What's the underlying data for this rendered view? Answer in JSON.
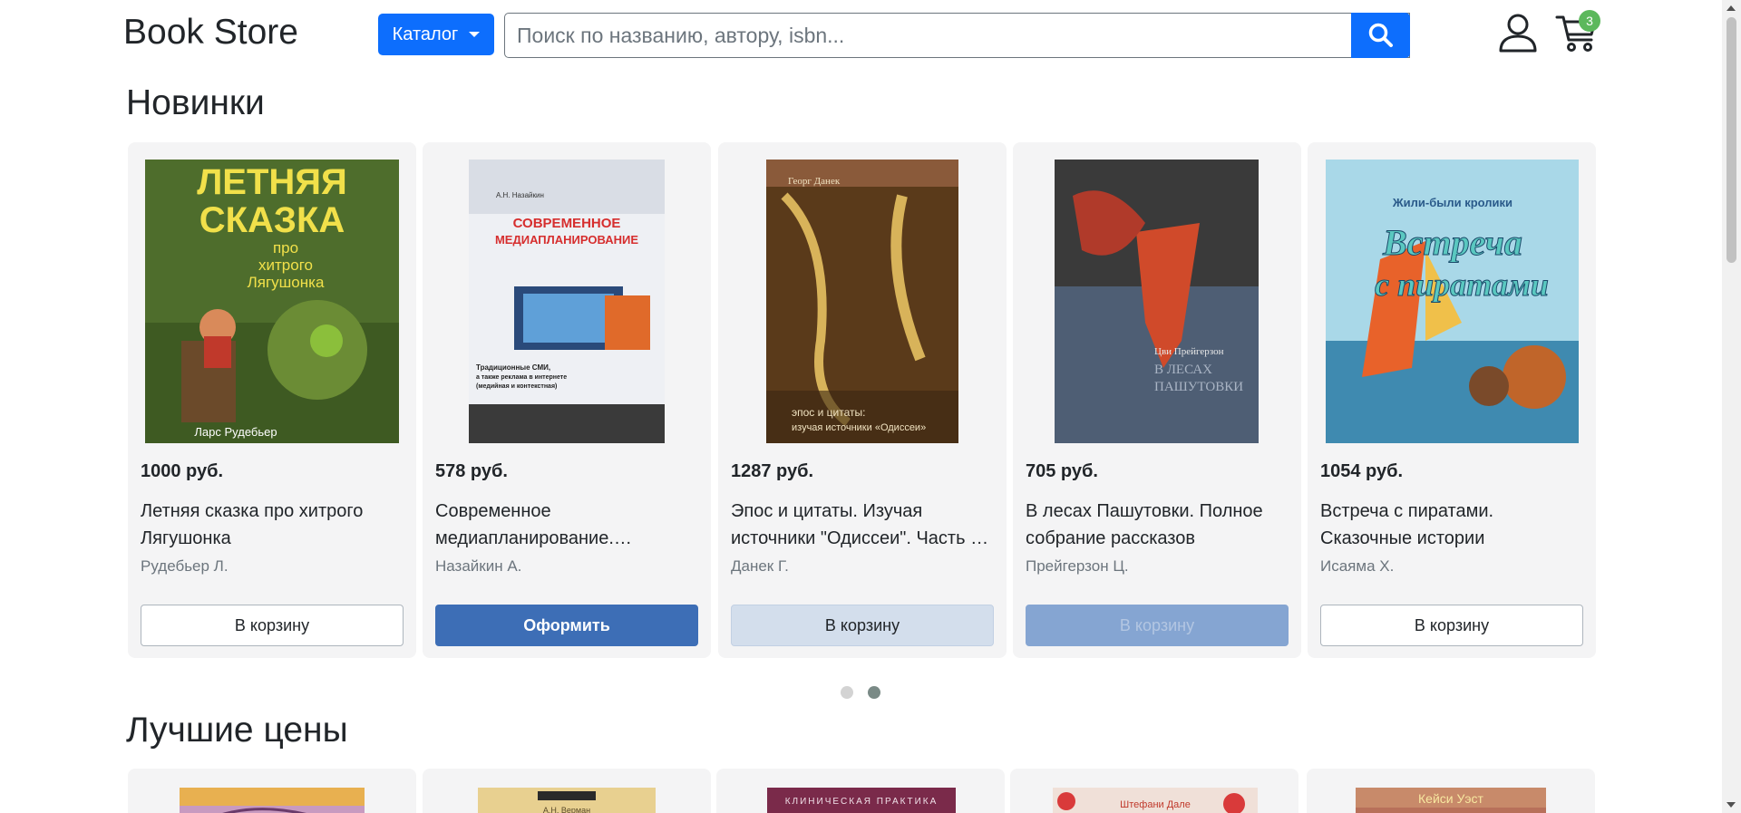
{
  "header": {
    "logo": "Book Store",
    "catalog_label": "Каталог",
    "search_placeholder": "Поиск по названию, автору, isbn...",
    "cart_count": "3"
  },
  "sections": {
    "new_title": "Новинки",
    "best_title": "Лучшие цены"
  },
  "new_books": [
    {
      "price": "1000 руб.",
      "title": "Летняя сказка про хитрого Лягушонка",
      "author": "Рудебьер Л.",
      "button": "В корзину",
      "button_style": "outline",
      "cover_text": [
        "ЛЕТНЯЯ",
        "СКАЗКА",
        "про",
        "хитрого",
        "Лягушонка",
        "Ларс Рудебьер"
      ]
    },
    {
      "price": "578 руб.",
      "title": "Современное медиапланирование.…",
      "author": "Назайкин А.",
      "button": "Оформить",
      "button_style": "primary",
      "cover_text": [
        "А.Н. Назайкин",
        "СОВРЕМЕННОЕ",
        "МЕДИАПЛАНИРОВАНИЕ",
        "Традиционные СМИ,",
        "а также реклама в интернете",
        "(медийная и контекстная)"
      ]
    },
    {
      "price": "1287 руб.",
      "title": "Эпос и цитаты. Изучая источники \"Одиссеи\". Часть …",
      "author": "Данек Г.",
      "button": "В корзину",
      "button_style": "light",
      "cover_text": [
        "Георг Данек",
        "эпос и цитаты:",
        "изучая источники «Одиссеи»"
      ]
    },
    {
      "price": "705 руб.",
      "title": "В лесах Пашутовки. Полное собрание рассказов",
      "author": "Прейгерзон Ц.",
      "button": "В корзину",
      "button_style": "disabled",
      "cover_text": [
        "Цви Прейгерзон",
        "В ЛЕСАХ",
        "ПАШУТОВКИ"
      ]
    },
    {
      "price": "1054 руб.",
      "title": "Встреча с пиратами. Сказочные истории",
      "author": "Исаяма Х.",
      "button": "В корзину",
      "button_style": "outline",
      "cover_text": [
        "Жили-были кролики",
        "Встреча",
        "с пиратами"
      ]
    }
  ],
  "best_covers": [
    {
      "text": ""
    },
    {
      "text": "А.Н. Верман"
    },
    {
      "text": "КЛИНИЧЕСКАЯ ПРАКТИКА"
    },
    {
      "text": "Штефани Дале"
    },
    {
      "text": "Кейси Уэст"
    }
  ],
  "colors": {
    "primary": "#0d6efd",
    "badge": "#5cb85c",
    "card_bg": "#f4f4f5"
  },
  "carousel": {
    "pages": 2,
    "active": 2
  }
}
